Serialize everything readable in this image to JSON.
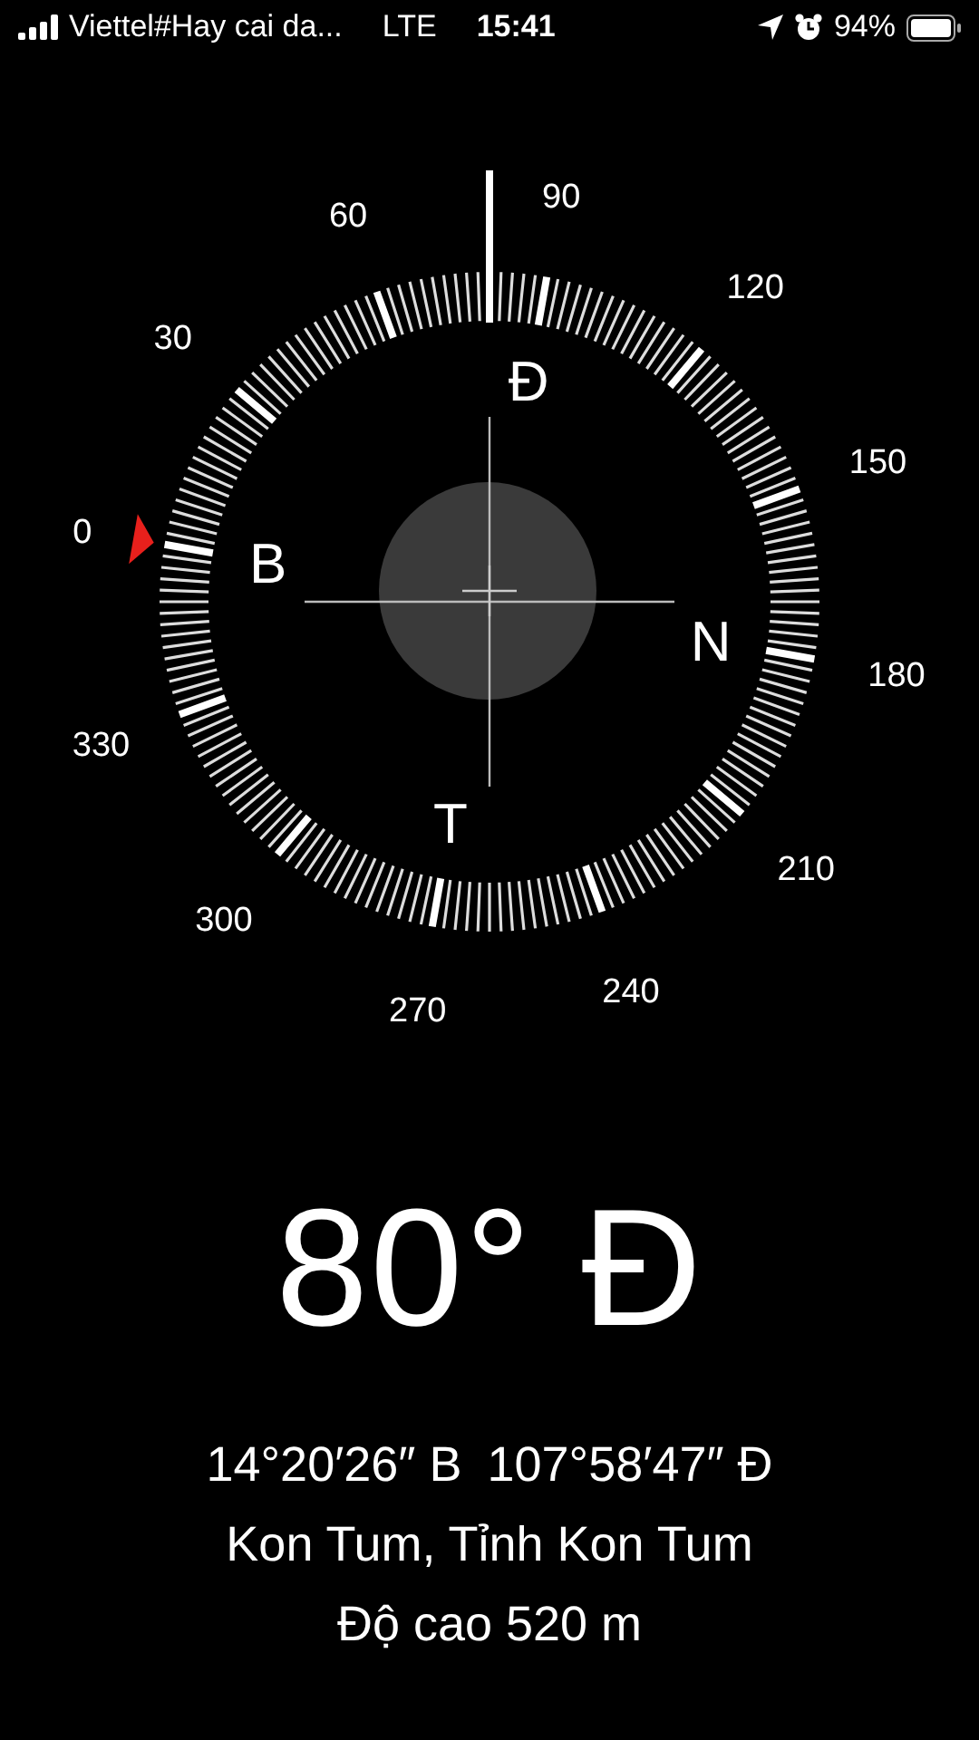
{
  "status_bar": {
    "carrier": "Viettel#Hay cai da...",
    "network": "LTE",
    "time": "15:41",
    "battery": "94%"
  },
  "compass": {
    "degree_labels": [
      "0",
      "30",
      "60",
      "90",
      "120",
      "150",
      "180",
      "210",
      "240",
      "270",
      "300",
      "330"
    ],
    "cardinals": [
      "B",
      "Đ",
      "N",
      "T"
    ]
  },
  "heading": "80° Đ",
  "location": {
    "latitude": "14°20′26″ B",
    "longitude": "107°58′47″ Đ",
    "place": "Kon Tum, Tỉnh Kon Tum",
    "altitude": "Độ cao 520 m"
  }
}
